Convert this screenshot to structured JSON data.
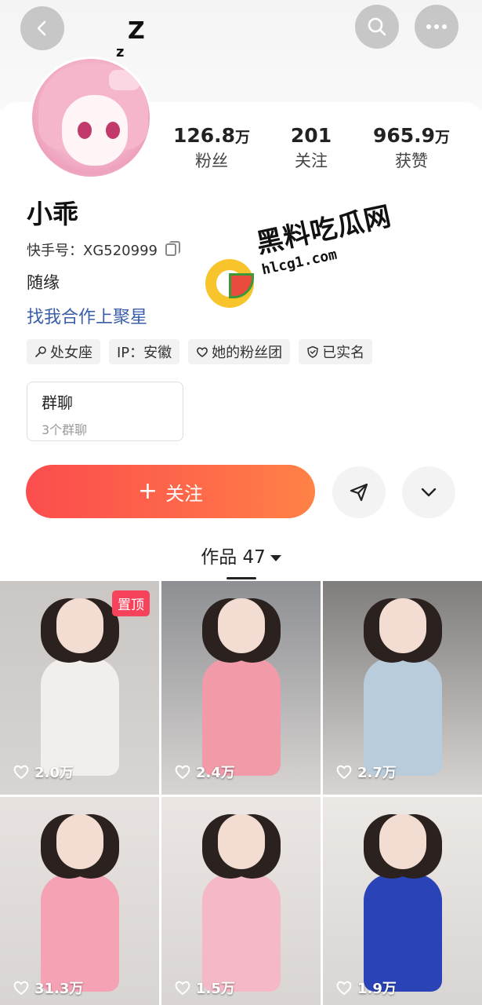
{
  "profile": {
    "name": "小乖",
    "kuaishou_id": "快手号：XG520999",
    "bio": "随缘",
    "collab_link": "找我合作上聚星",
    "stats": [
      {
        "value": "126.8",
        "unit": "万",
        "label": "粉丝"
      },
      {
        "value": "201",
        "unit": "",
        "label": "关注"
      },
      {
        "value": "965.9",
        "unit": "万",
        "label": "获赞"
      }
    ],
    "sleep_mark": [
      "Z",
      "z"
    ]
  },
  "tags": [
    {
      "icon": "zodiac-icon",
      "label": "处女座"
    },
    {
      "icon": "",
      "label": "IP：安徽"
    },
    {
      "icon": "heart-icon",
      "label": "她的粉丝团"
    },
    {
      "icon": "shield-check-icon",
      "label": "已实名"
    }
  ],
  "group_chat": {
    "title": "群聊",
    "subtitle": "3个群聊"
  },
  "actions": {
    "follow_plus": "+",
    "follow_label": "关注"
  },
  "works_tab": {
    "label": "作品 47"
  },
  "watermark": {
    "title": "黑料吃瓜网",
    "url": "hlcg1.com"
  },
  "posts": [
    {
      "likes": "2.0万",
      "pinned": "置顶",
      "bg": "#c9c6c4",
      "outfit": "#f1eeec"
    },
    {
      "likes": "2.4万",
      "pinned": "",
      "bg": "#8d8f93",
      "outfit": "#f19aa8"
    },
    {
      "likes": "2.7万",
      "pinned": "",
      "bg": "#7e7d7b",
      "outfit": "#b9ccdc"
    },
    {
      "likes": "31.3万",
      "pinned": "",
      "bg": "#e7e2df",
      "outfit": "#f4a2b4"
    },
    {
      "likes": "1.5万",
      "pinned": "",
      "bg": "#ebe6e3",
      "outfit": "#f5b8c6"
    },
    {
      "likes": "1.9万",
      "pinned": "",
      "bg": "#ece8e5",
      "outfit": "#2a44b8"
    }
  ],
  "colors": {
    "follow_start": "#fb4d4d",
    "follow_end": "#ff8246",
    "link": "#3a5ea8",
    "pin": "#f6435b"
  }
}
